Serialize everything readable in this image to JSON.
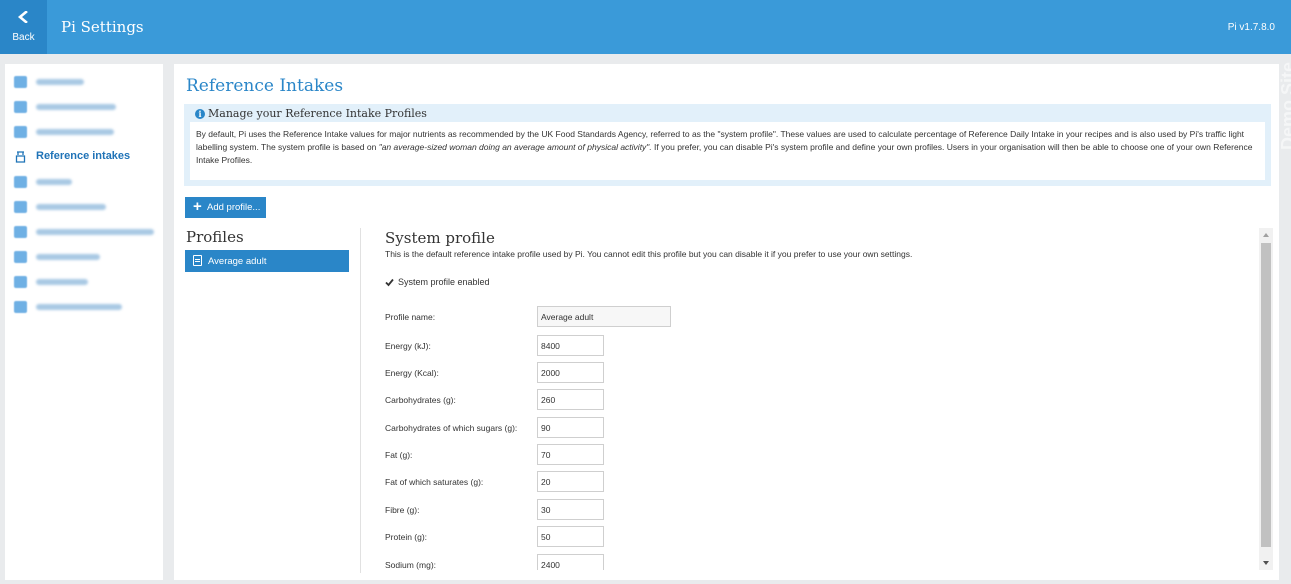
{
  "header": {
    "back_label": "Back",
    "title": "Pi Settings",
    "version": "Pi v1.7.8.0"
  },
  "watermark": {
    "text": "Demo Site"
  },
  "sidebar": {
    "items": [
      {
        "label": "",
        "blurred": true,
        "icon": "person-icon"
      },
      {
        "label": "",
        "blurred": true,
        "icon": "users-icon"
      },
      {
        "label": "",
        "blurred": true,
        "icon": "organisation-icon"
      },
      {
        "label": "Reference intakes",
        "blurred": false,
        "active": true,
        "icon": "beaker-icon"
      },
      {
        "label": "",
        "blurred": true,
        "icon": "group-icon"
      },
      {
        "label": "",
        "blurred": true,
        "icon": "category-icon"
      },
      {
        "label": "",
        "blurred": true,
        "icon": "key-icon"
      },
      {
        "label": "",
        "blurred": true,
        "icon": "gear-icon"
      },
      {
        "label": "",
        "blurred": true,
        "icon": "wrench-icon"
      },
      {
        "label": "",
        "blurred": true,
        "icon": "settings-icon"
      }
    ]
  },
  "main": {
    "page_title": "Reference Intakes",
    "info": {
      "heading": "Manage your Reference Intake Profiles",
      "text_part1": "By default, Pi uses the Reference Intake values for major nutrients as recommended by the UK Food Standards Agency, referred to as the \"system profile\". These values are used to calculate percentage of Reference Daily Intake in your recipes and is also used by Pi's traffic light labelling system. The system profile is based on ",
      "text_em": "\"an average-sized woman doing an average amount of physical activity\".",
      "text_part2": " If you prefer, you can disable Pi's system profile and define your own profiles. Users in your organisation will then be able to choose one of your own Reference Intake Profiles."
    },
    "add_profile_label": "Add profile...",
    "profiles_title": "Profiles",
    "profiles": [
      {
        "label": "Average adult",
        "selected": true
      }
    ],
    "system_profile": {
      "title": "System profile",
      "description": "This is the default reference intake profile used by Pi. You cannot edit this profile but you can disable it if you prefer to use your own settings.",
      "enabled_label": "System profile enabled",
      "enabled": true,
      "name_label": "Profile name:",
      "name_value": "Average adult",
      "fields": [
        {
          "label": "Energy (kJ):",
          "value": "8400"
        },
        {
          "label": "Energy (Kcal):",
          "value": "2000"
        },
        {
          "label": "Carbohydrates (g):",
          "value": "260"
        },
        {
          "label": "Carbohydrates of which sugars (g):",
          "value": "90"
        },
        {
          "label": "Fat (g):",
          "value": "70"
        },
        {
          "label": "Fat of which saturates (g):",
          "value": "20"
        },
        {
          "label": "Fibre (g):",
          "value": "30"
        },
        {
          "label": "Protein (g):",
          "value": "50"
        },
        {
          "label": "Sodium (mg):",
          "value": "2400"
        }
      ]
    }
  },
  "colors": {
    "header": "#3a9ad9",
    "accent": "#2a86c8",
    "info_bg": "#e2f0fa",
    "page_bg": "#e9ebed"
  }
}
